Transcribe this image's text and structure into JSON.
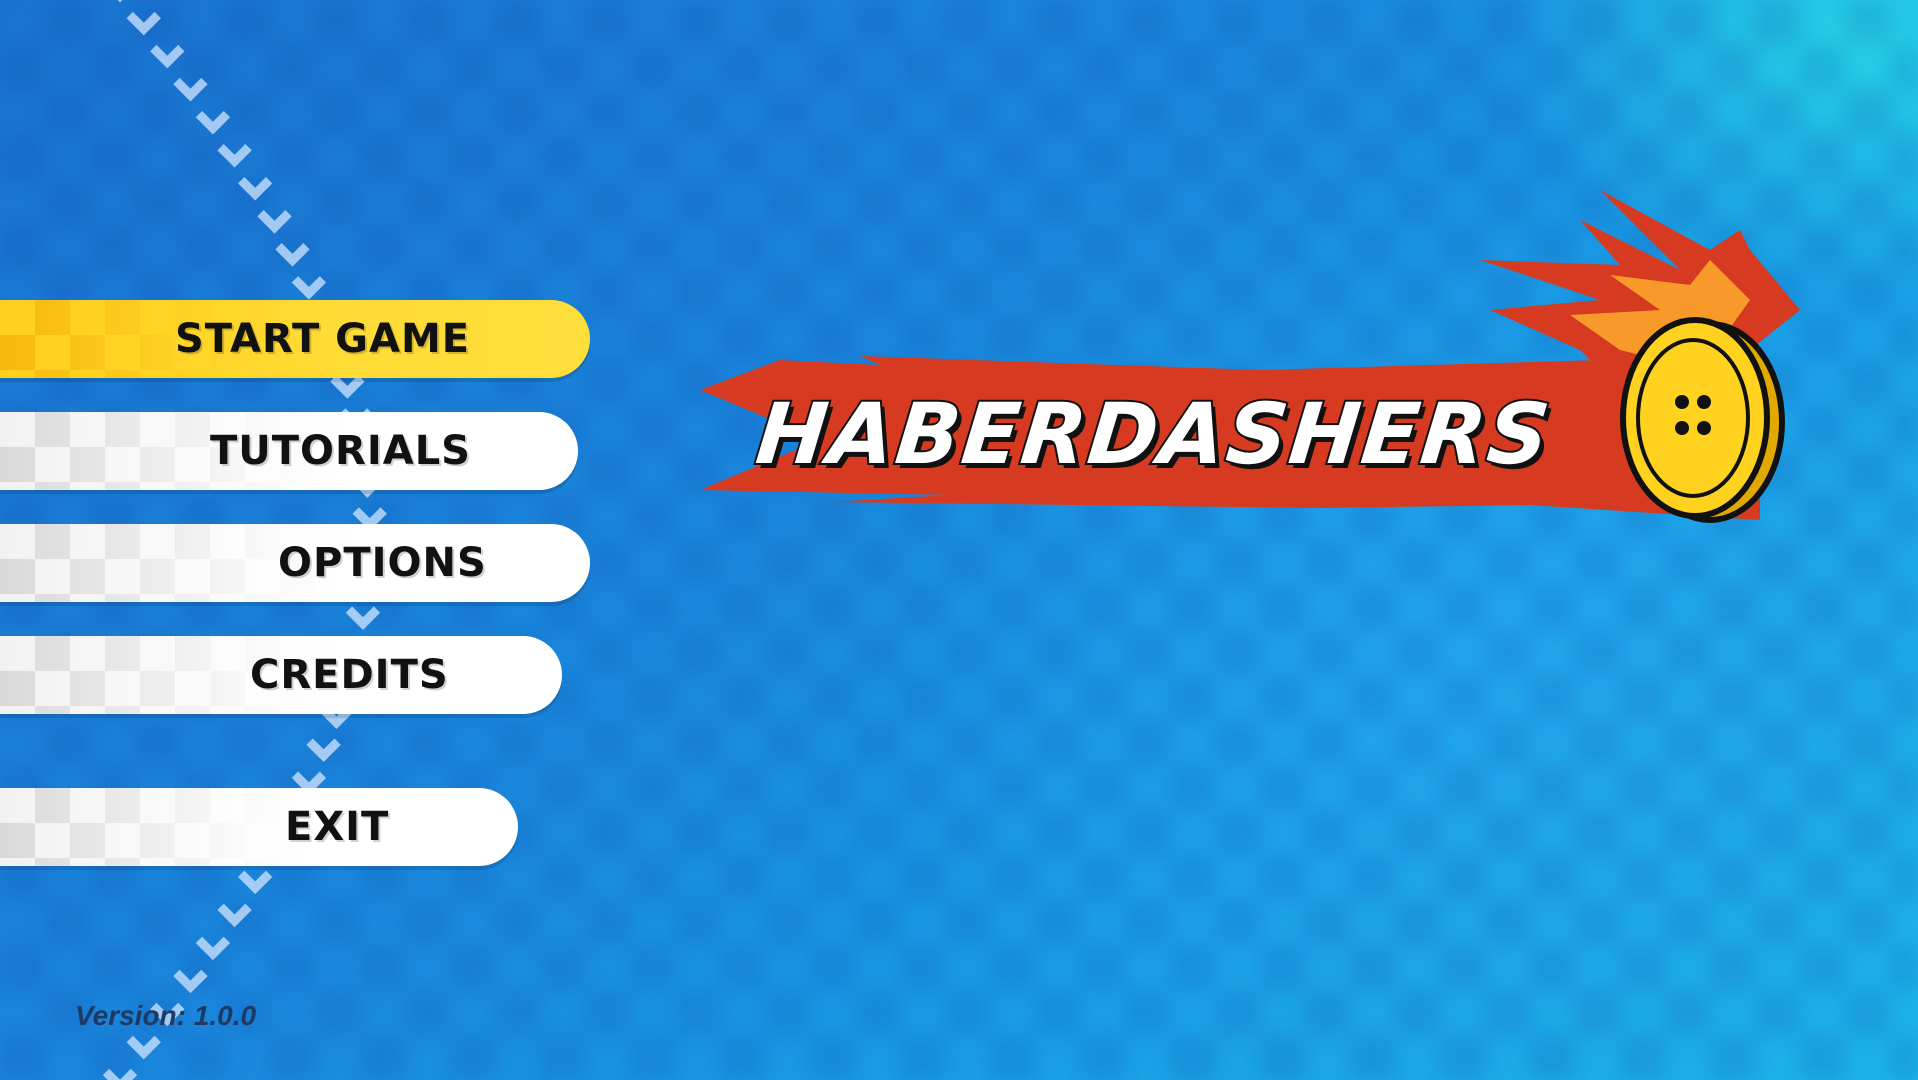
{
  "game": {
    "title": "HABERDASHERS"
  },
  "menu": {
    "items": [
      {
        "label": "START GAME",
        "selected": true
      },
      {
        "label": "TUTORIALS",
        "selected": false
      },
      {
        "label": "OPTIONS",
        "selected": false
      },
      {
        "label": "CREDITS",
        "selected": false
      },
      {
        "label": "EXIT",
        "selected": false
      }
    ]
  },
  "footer": {
    "version": "Version: 1.0.0"
  },
  "colors": {
    "accent_yellow": "#ffd62e",
    "button_white": "#ffffff",
    "background_blue": "#1a86dc",
    "logo_flame_red": "#d63a20",
    "logo_flame_orange": "#f79a2a",
    "coin_yellow": "#ffd21f"
  },
  "icons": [
    "button-coin-icon",
    "arrow-trail-icon"
  ]
}
